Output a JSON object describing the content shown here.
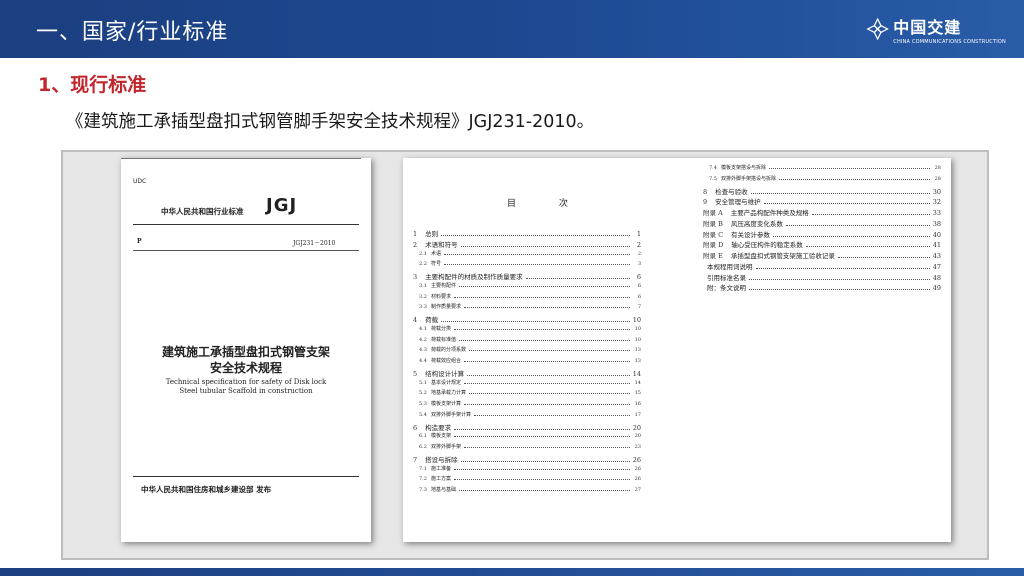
{
  "header": {
    "title": "一、国家/行业标准",
    "logo_cn": "中国交建",
    "logo_en": "CHINA COMMUNICATIONS CONSTRUCTION"
  },
  "section": {
    "heading": "1、现行标准",
    "caption": "《建筑施工承插型盘扣式钢管脚手架安全技术规程》JGJ231-2010。"
  },
  "cover": {
    "udc": "UDC",
    "standard_line": "中华人民共和国行业标准",
    "logo": "JGJ",
    "p_mark": "P",
    "code": "JGJ231－2010",
    "title_line1": "建筑施工承插型盘扣式钢管支架",
    "title_line2": "安全技术规程",
    "en_line1": "Technical specification for safety of   Disk lock",
    "en_line2": "Steel tubular Scaffold in construction",
    "issuer": "中华人民共和国住房和城乡建设部    发布"
  },
  "toc": {
    "title": "目 次",
    "left": [
      {
        "num": "1",
        "title": "总则",
        "page": "1",
        "sub": false
      },
      {
        "num": "2",
        "title": "术语和符号",
        "page": "2",
        "sub": false
      },
      {
        "num": "2.1",
        "title": "术语",
        "page": "2",
        "sub": true
      },
      {
        "num": "2.2",
        "title": "符号",
        "page": "3",
        "sub": true
      },
      {
        "num": "3",
        "title": "主要构配件的材质及制作质量要求",
        "page": "6",
        "sub": false
      },
      {
        "num": "3.1",
        "title": "主要构配件",
        "page": "6",
        "sub": true
      },
      {
        "num": "3.2",
        "title": "材料要求",
        "page": "6",
        "sub": true
      },
      {
        "num": "3.3",
        "title": "制作质量要求",
        "page": "7",
        "sub": true
      },
      {
        "num": "4",
        "title": "荷载",
        "page": "10",
        "sub": false
      },
      {
        "num": "4.1",
        "title": "荷载分类",
        "page": "10",
        "sub": true
      },
      {
        "num": "4.2",
        "title": "荷载标准值",
        "page": "10",
        "sub": true
      },
      {
        "num": "4.3",
        "title": "荷载的分项系数",
        "page": "13",
        "sub": true
      },
      {
        "num": "4.4",
        "title": "荷载效应组合",
        "page": "13",
        "sub": true
      },
      {
        "num": "5",
        "title": "结构设计计算",
        "page": "14",
        "sub": false
      },
      {
        "num": "5.1",
        "title": "基本设计规定",
        "page": "14",
        "sub": true
      },
      {
        "num": "5.2",
        "title": "地基承载力计算",
        "page": "15",
        "sub": true
      },
      {
        "num": "5.3",
        "title": "模板支架计算",
        "page": "16",
        "sub": true
      },
      {
        "num": "5.4",
        "title": "双排外脚手架计算",
        "page": "17",
        "sub": true
      },
      {
        "num": "6",
        "title": "构造要求",
        "page": "20",
        "sub": false
      },
      {
        "num": "6.1",
        "title": "模板支架",
        "page": "20",
        "sub": true
      },
      {
        "num": "6.2",
        "title": "双排外脚手架",
        "page": "23",
        "sub": true
      },
      {
        "num": "7",
        "title": "搭设与拆除",
        "page": "26",
        "sub": false
      },
      {
        "num": "7.1",
        "title": "施工准备",
        "page": "26",
        "sub": true
      },
      {
        "num": "7.2",
        "title": "施工方案",
        "page": "26",
        "sub": true
      },
      {
        "num": "7.3",
        "title": "地基与基础",
        "page": "27",
        "sub": true
      }
    ],
    "right": [
      {
        "num": "7.4",
        "title": "模板支架搭设与拆除",
        "page": "28",
        "sub": true
      },
      {
        "num": "7.5",
        "title": "双排外脚手架搭设与拆除",
        "page": "28",
        "sub": true
      },
      {
        "num": "8",
        "title": "检查与验收",
        "page": "30",
        "sub": false
      },
      {
        "num": "9",
        "title": "安全管理与维护",
        "page": "32",
        "sub": false
      },
      {
        "num": "附录 A",
        "title": "主要产品构配件种类及规格",
        "page": "33",
        "sub": false
      },
      {
        "num": "附录 B",
        "title": "风压高度变化系数",
        "page": "38",
        "sub": false
      },
      {
        "num": "附录 C",
        "title": "有关设计参数",
        "page": "40",
        "sub": false
      },
      {
        "num": "附录 D",
        "title": "轴心受压构件的稳定系数",
        "page": "41",
        "sub": false
      },
      {
        "num": "附录 E",
        "title": "承插型盘扣式钢管支架施工验收记录",
        "page": "43",
        "sub": false
      },
      {
        "num": "",
        "title": "本规程用词说明",
        "page": "47",
        "sub": false
      },
      {
        "num": "",
        "title": "引用标准名录",
        "page": "48",
        "sub": false
      },
      {
        "num": "",
        "title": "附：条文说明",
        "page": "49",
        "sub": false
      }
    ]
  },
  "colors": {
    "header_blue": "#1d4a93",
    "heading_red": "#c0262c"
  }
}
